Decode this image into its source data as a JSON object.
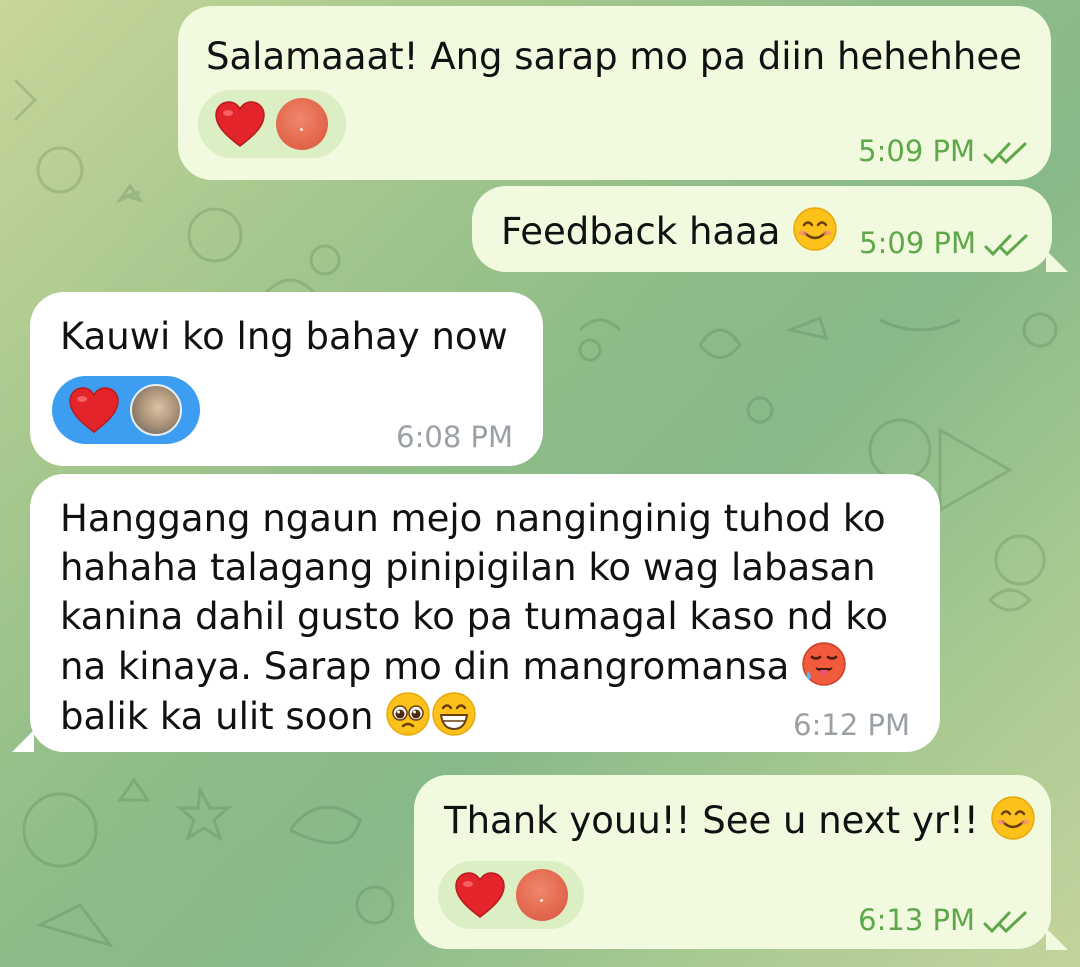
{
  "messages": [
    {
      "text": "Salamaaat! Ang sarap mo pa diin hehehhee",
      "time": "5:09 PM",
      "direction": "outgoing",
      "status": "read",
      "reactions": [
        "heart",
        "avatar"
      ]
    },
    {
      "text": "Feedback haaa",
      "emoji": [
        "smiling-face"
      ],
      "time": "5:09 PM",
      "direction": "outgoing",
      "status": "read"
    },
    {
      "text": "Kauwi ko lng bahay now",
      "time": "6:08 PM",
      "direction": "incoming",
      "reactions": [
        "heart",
        "avatar"
      ]
    },
    {
      "lines": [
        "Hanggang ngaun mejo nanginginig tuhod ko",
        "hahaha talagang pinipigilan ko wag labasan",
        "kanina dahil gusto ko pa tumagal kaso nd ko",
        "na kinaya. Sarap mo din mangromansa",
        "balik ka ulit soon"
      ],
      "emoji": [
        "hot-face",
        "pleading-face",
        "grinning-face"
      ],
      "time": "6:12 PM",
      "direction": "incoming"
    },
    {
      "text": "Thank youu!! See u next yr!!",
      "emoji": [
        "smiling-face"
      ],
      "time": "6:13 PM",
      "direction": "outgoing",
      "status": "read",
      "reactions": [
        "heart",
        "avatar"
      ]
    }
  ],
  "colors": {
    "outgoing_bubble": "#f1f9df",
    "incoming_bubble": "#ffffff",
    "outgoing_time": "#5fa84a",
    "incoming_time": "#9aa0a6",
    "reaction_out": "#dcefc4",
    "reaction_in": "#3d9df0",
    "heart": "#e3242b"
  }
}
